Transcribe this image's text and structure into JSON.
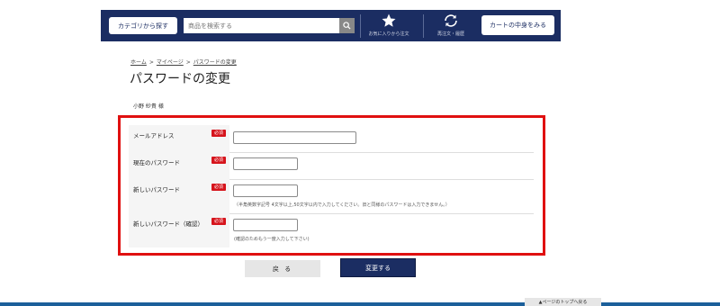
{
  "header": {
    "category_button": "カテゴリから探す",
    "search_placeholder": "商品を検索する",
    "favorites_label": "お気に入りから注文",
    "reorder_label": "再注文・履歴",
    "cart_button": "カートの中身をみる"
  },
  "breadcrumb": [
    "ホーム",
    "マイページ",
    "パスワードの変更"
  ],
  "breadcrumb_separator": ">",
  "page_title": "パスワードの変更",
  "user_name": "小野 紗貴 様",
  "required_badge": "必須",
  "form": {
    "email": {
      "label": "メールアドレス",
      "value": ""
    },
    "current_password": {
      "label": "現在のパスワード",
      "value": ""
    },
    "new_password": {
      "label": "新しいパスワード",
      "value": "",
      "hint": "（半角英数字記号 4文字以上,50文字以内で入力してください。旧と同様のパスワードは入力できません。）"
    },
    "confirm_password": {
      "label": "新しいパスワード（確認）",
      "value": "",
      "hint": "(確認のためもう一度入力して下さい)"
    }
  },
  "buttons": {
    "back": "戻 る",
    "submit": "変更する"
  },
  "page_top": "▲ページのトップへ戻る",
  "colors": {
    "navy": "#1b2d62",
    "required": "#d6141c",
    "highlight_frame": "#e01010",
    "footer": "#1b5f9a"
  }
}
